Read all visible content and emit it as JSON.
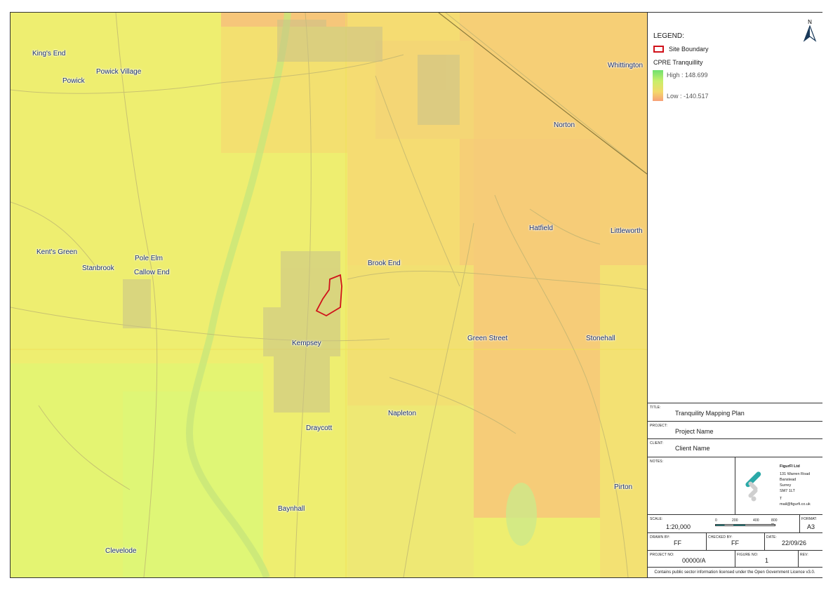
{
  "map": {
    "places": [
      {
        "name": "King's End"
      },
      {
        "name": "Powick"
      },
      {
        "name": "Powick Village"
      },
      {
        "name": "Whittington"
      },
      {
        "name": "Norton"
      },
      {
        "name": "Hatfield"
      },
      {
        "name": "Littleworth"
      },
      {
        "name": "Kent's Green"
      },
      {
        "name": "Pole Elm"
      },
      {
        "name": "Stanbrook"
      },
      {
        "name": "Callow End"
      },
      {
        "name": "Brook End"
      },
      {
        "name": "Kempsey"
      },
      {
        "name": "Green Street"
      },
      {
        "name": "Stonehall"
      },
      {
        "name": "Napleton"
      },
      {
        "name": "Draycott"
      },
      {
        "name": "Pirton"
      },
      {
        "name": "Baynhall"
      },
      {
        "name": "Clevelode"
      }
    ],
    "colors": {
      "high": "#6fe06f",
      "mid": "#e8ee70",
      "low": "#f7a078",
      "boundary": "#d0111a"
    }
  },
  "legend": {
    "title": "LEGEND:",
    "site_boundary": "Site Boundary",
    "layer_title": "CPRE Tranquillity",
    "high_label": "High : 148.699",
    "low_label": "Low : -140.517",
    "north": "N"
  },
  "titleblock": {
    "title_label": "TITLE:",
    "title": "Tranquility Mapping Plan",
    "project_label": "PROJECT:",
    "project": "Project Name",
    "client_label": "CLIENT:",
    "client": "Client Name",
    "notes_label": "NOTES:",
    "company": {
      "name": "FigurFI Ltd",
      "address1": "131 Warren Road",
      "address2": "Banstead",
      "address3": "Surrey",
      "postcode": "SM7 1LT",
      "phone_label": "T",
      "email": "mail@figurfi.co.uk"
    },
    "scale_label": "SCALE:",
    "scale": "1:20,000",
    "scalebar_ticks": [
      "0",
      "200",
      "400",
      "800 m"
    ],
    "format_label": "FORMAT:",
    "format": "A3",
    "drawn_label": "DRAWN BY:",
    "drawn": "FF",
    "checked_label": "CHECKED BY:",
    "checked": "FF",
    "date_label": "DATE:",
    "date": "22/09/26",
    "project_no_label": "PROJECT NO:",
    "project_no": "00000/A",
    "figure_label": "FIGURE NO:",
    "figure": "1",
    "rev_label": "REV:",
    "rev": ""
  },
  "footer": "Contains public sector information licensed under the Open Government Licence v3.0."
}
